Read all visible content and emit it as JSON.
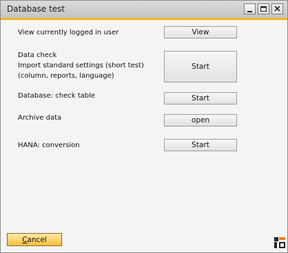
{
  "window": {
    "title": "Database test"
  },
  "rows": {
    "view_user": {
      "label": "View currently logged in user",
      "button": "View"
    },
    "data_check": {
      "lines": [
        "Data check",
        "Import standard settings (short test)",
        "(column, reports, language)"
      ],
      "button": "Start"
    },
    "check_table": {
      "label": "Database: check table",
      "button": "Start"
    },
    "archive": {
      "label": "Archive data",
      "button": "open"
    },
    "hana": {
      "label": "HANA: conversion",
      "button": "Start"
    }
  },
  "footer": {
    "cancel_accel": "C",
    "cancel_rest": "ancel"
  },
  "colors": {
    "accent": "#f2b21e",
    "logo_orange": "#e8821e"
  },
  "icons": [
    "minimize-icon",
    "maximize-icon",
    "close-icon",
    "app-logo-icon"
  ]
}
